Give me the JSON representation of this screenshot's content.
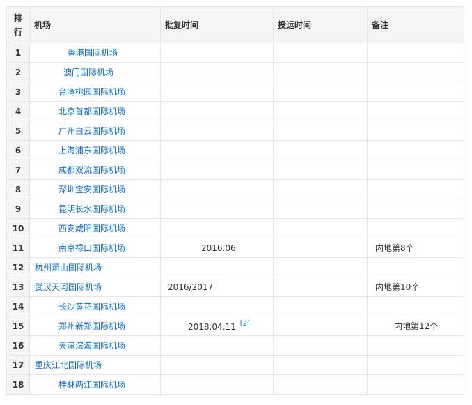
{
  "header": {
    "rank_line1": "排",
    "rank_line2": "行",
    "airport": "机场",
    "approval": "批复时间",
    "operation": "投运时间",
    "note": "备注"
  },
  "rows": [
    {
      "rank": "1",
      "airport": "香港国际机场",
      "approval": "",
      "ref": "",
      "operation": "",
      "note": ""
    },
    {
      "rank": "2",
      "airport": "澳门国际机场",
      "approval": "",
      "ref": "",
      "operation": "",
      "note": ""
    },
    {
      "rank": "3",
      "airport": "台湾桃园国际机场",
      "approval": "",
      "ref": "",
      "operation": "",
      "note": ""
    },
    {
      "rank": "4",
      "airport": "北京首都国际机场",
      "approval": "",
      "ref": "",
      "operation": "",
      "note": ""
    },
    {
      "rank": "5",
      "airport": "广州白云国际机场",
      "approval": "",
      "ref": "",
      "operation": "",
      "note": ""
    },
    {
      "rank": "6",
      "airport": "上海浦东国际机场",
      "approval": "",
      "ref": "",
      "operation": "",
      "note": ""
    },
    {
      "rank": "7",
      "airport": "成都双流国际机场",
      "approval": "",
      "ref": "",
      "operation": "",
      "note": ""
    },
    {
      "rank": "8",
      "airport": "深圳宝安国际机场",
      "approval": "",
      "ref": "",
      "operation": "",
      "note": ""
    },
    {
      "rank": "9",
      "airport": "昆明长水国际机场",
      "approval": "",
      "ref": "",
      "operation": "",
      "note": ""
    },
    {
      "rank": "10",
      "airport": "西安咸阳国际机场",
      "approval": "",
      "ref": "",
      "operation": "",
      "note": ""
    },
    {
      "rank": "11",
      "airport": "南京禄口国际机场",
      "approval": "2016.06",
      "ref": "",
      "operation": "",
      "note": "内地第8个"
    },
    {
      "rank": "12",
      "airport": "杭州萧山国际机场",
      "approval": "",
      "ref": "",
      "operation": "",
      "note": ""
    },
    {
      "rank": "13",
      "airport": "武汉天河国际机场",
      "approval": "2016/2017",
      "ref": "",
      "operation": "",
      "note": "内地第10个"
    },
    {
      "rank": "14",
      "airport": "长沙黄花国际机场",
      "approval": "",
      "ref": "",
      "operation": "",
      "note": ""
    },
    {
      "rank": "15",
      "airport": "郑州新郑国际机场",
      "approval": "2018.04.11",
      "ref": "[2]",
      "operation": "",
      "note": "内地第12个"
    },
    {
      "rank": "16",
      "airport": "天津滨海国际机场",
      "approval": "",
      "ref": "",
      "operation": "",
      "note": ""
    },
    {
      "rank": "17",
      "airport": "重庆江北国际机场",
      "approval": "",
      "ref": "",
      "operation": "",
      "note": ""
    },
    {
      "rank": "18",
      "airport": "桂林两江国际机场",
      "approval": "",
      "ref": "",
      "operation": "",
      "note": ""
    }
  ],
  "colors": {
    "link": "#136ec2",
    "header_bg": "#f5f5f5",
    "border": "#e6e6e6"
  }
}
